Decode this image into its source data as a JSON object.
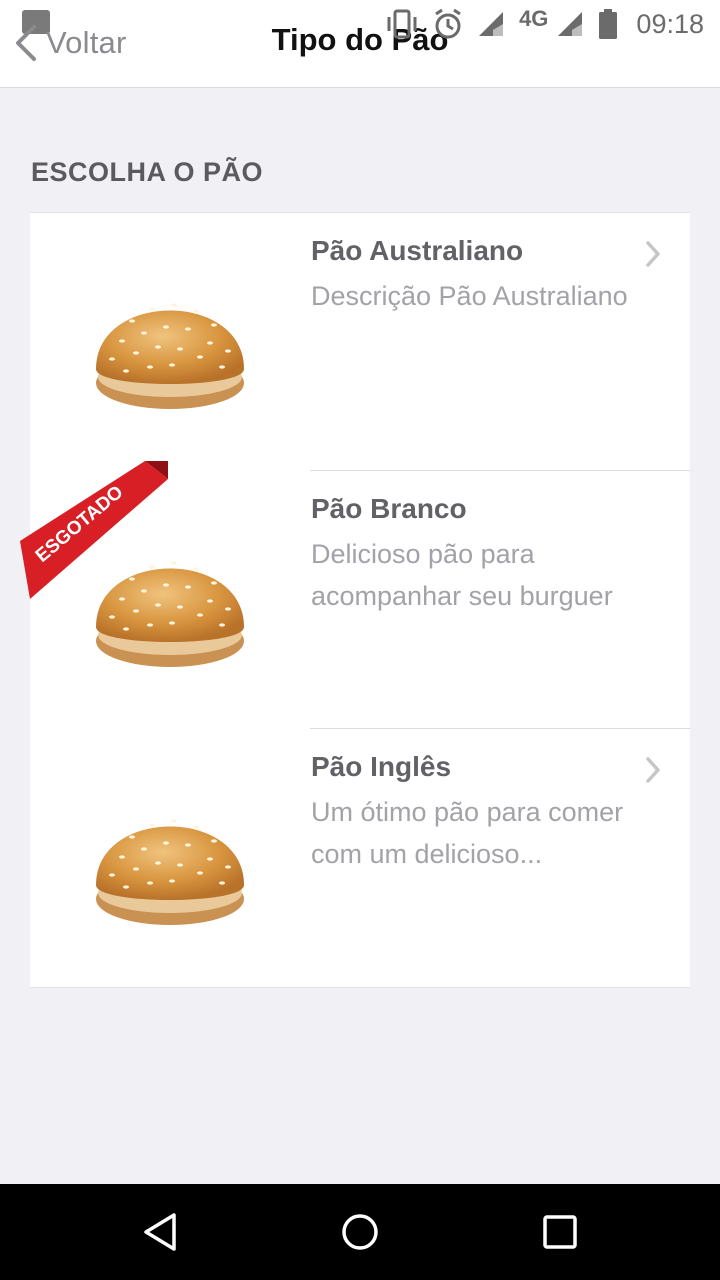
{
  "status_bar": {
    "network": "4G",
    "time": "09:18",
    "icons": [
      "image-icon",
      "vibrate-icon",
      "alarm-icon",
      "signal-icon",
      "signal-icon",
      "battery-icon"
    ]
  },
  "nav": {
    "back_label": "Voltar",
    "title": "Tipo do Pão"
  },
  "section": {
    "title": "ESCOLHA O PÃO"
  },
  "items": [
    {
      "title": "Pão Australiano",
      "description": "Descrição Pão Australiano",
      "sold_out": false,
      "icon": "burger-bun-image"
    },
    {
      "title": "Pão Branco",
      "description": "Delicioso pão para acompanhar seu burguer",
      "sold_out": true,
      "badge": "ESGOTADO",
      "icon": "burger-bun-image"
    },
    {
      "title": "Pão Inglês",
      "description": "Um ótimo pão para comer com um delicioso...",
      "sold_out": false,
      "icon": "burger-bun-image"
    }
  ],
  "colors": {
    "background": "#f1f0f5",
    "badge_red": "#d81f26",
    "title_text": "#616166",
    "desc_text": "#a2a2a8"
  }
}
